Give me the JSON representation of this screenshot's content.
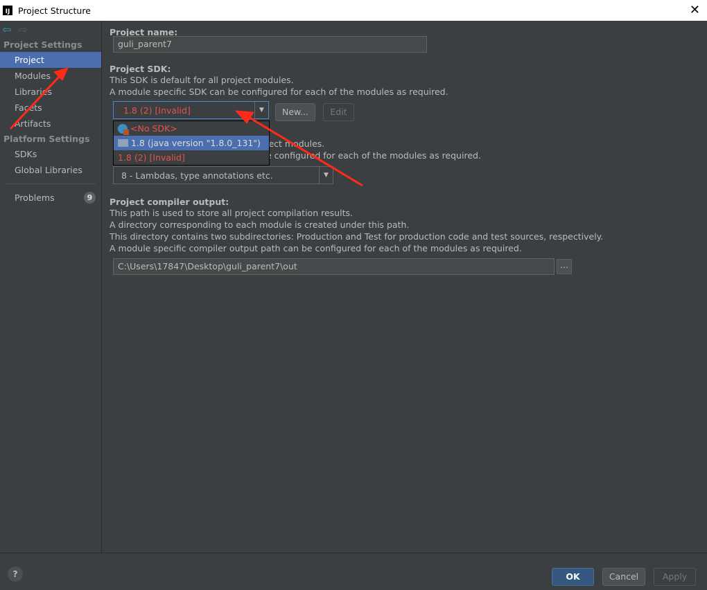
{
  "window": {
    "title": "Project Structure",
    "icon_text": "IJ"
  },
  "sidebar": {
    "sections": [
      {
        "title": "Project Settings",
        "items": [
          "Project",
          "Modules",
          "Libraries",
          "Facets",
          "Artifacts"
        ]
      },
      {
        "title": "Platform Settings",
        "items": [
          "SDKs",
          "Global Libraries"
        ]
      }
    ],
    "selected": "Project",
    "problems": {
      "label": "Problems",
      "count": "9"
    }
  },
  "main": {
    "name_label": "Project name:",
    "name_value": "guli_parent7",
    "sdk_label": "Project SDK:",
    "sdk_desc": [
      "This SDK is default for all project modules.",
      "A module specific SDK can be configured for each of the modules as required."
    ],
    "sdk_value": "1.8 (2) [Invalid]",
    "new_label": "New...",
    "edit_label": "Edit",
    "sdk_options": [
      "<No SDK>",
      "1.8 (java version \"1.8.0_131\")",
      "1.8 (2) [Invalid]"
    ],
    "lang_desc_visible": [
      "ject modules.",
      "e configured for each of the modules as required."
    ],
    "lang_value": "8 - Lambdas, type annotations etc.",
    "output_label": "Project compiler output:",
    "output_desc": [
      "This path is used to store all project compilation results.",
      "A directory corresponding to each module is created under this path.",
      "This directory contains two subdirectories: Production and Test for production code and test sources, respectively.",
      "A module specific compiler output path can be configured for each of the modules as required."
    ],
    "output_value": "C:\\Users\\17847\\Desktop\\guli_parent7\\out",
    "browse_label": "..."
  },
  "footer": {
    "help": "?",
    "ok": "OK",
    "cancel": "Cancel",
    "apply": "Apply"
  },
  "colors": {
    "selection": "#4b6eaf",
    "invalid": "#e5534b",
    "annotation_arrow": "#ff2a1a"
  }
}
